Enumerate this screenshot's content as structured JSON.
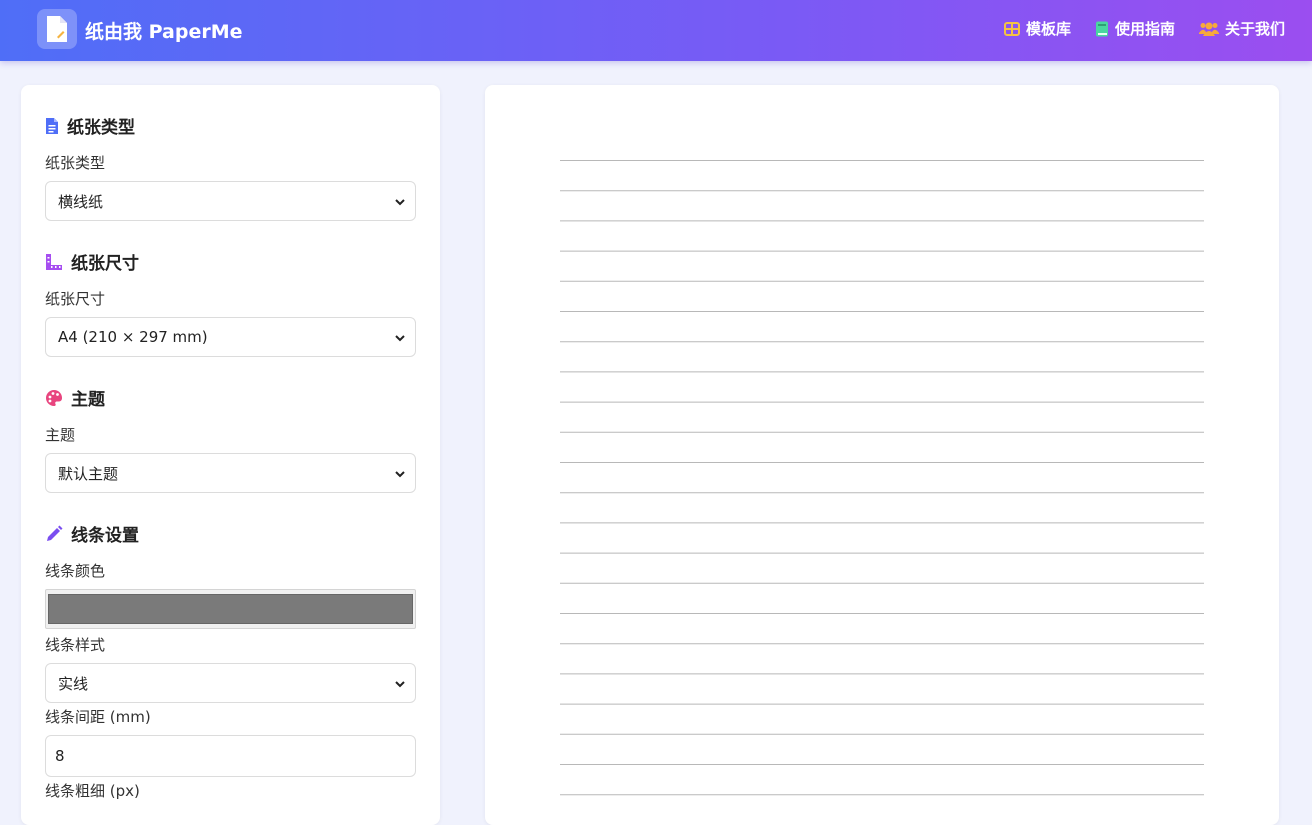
{
  "header": {
    "brand": "纸由我 PaperMe",
    "nav": [
      {
        "label": "模板库",
        "icon": "grid-icon",
        "color": "#f5c242"
      },
      {
        "label": "使用指南",
        "icon": "book-icon",
        "color": "#49d6a0"
      },
      {
        "label": "关于我们",
        "icon": "users-icon",
        "color": "#f7a93b"
      }
    ]
  },
  "settings": {
    "paper_type": {
      "title": "纸张类型",
      "label": "纸张类型",
      "value": "横线纸",
      "icon": "document-icon",
      "icon_color": "#4f6ef7"
    },
    "paper_size": {
      "title": "纸张尺寸",
      "label": "纸张尺寸",
      "value": "A4 (210 × 297 mm)",
      "icon": "ruler-icon",
      "icon_color": "#a64ef0"
    },
    "theme": {
      "title": "主题",
      "label": "主题",
      "value": "默认主题",
      "icon": "palette-icon",
      "icon_color": "#e8457f"
    },
    "line": {
      "title": "线条设置",
      "icon": "pencil-icon",
      "icon_color": "#7a4ef0",
      "color_label": "线条颜色",
      "color_value": "#7a7a7a",
      "style_label": "线条样式",
      "style_value": "实线",
      "spacing_label": "线条间距 (mm)",
      "spacing_value": "8",
      "width_label": "线条粗细 (px)"
    }
  },
  "preview": {
    "line_color": "#b8b8b8",
    "line_count": 22
  }
}
